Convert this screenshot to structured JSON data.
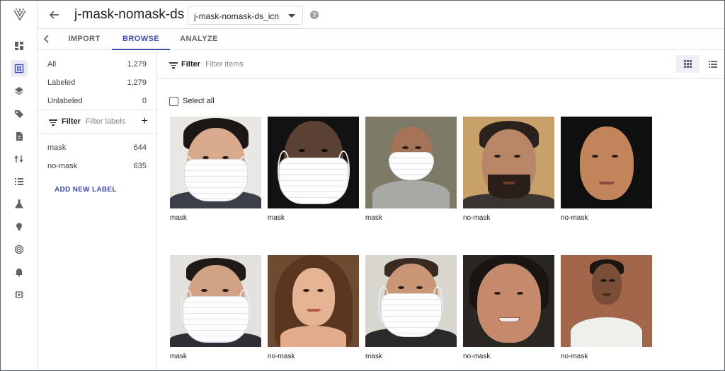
{
  "header": {
    "title": "j-mask-nomask-ds",
    "dataset_select": "j-mask-nomask-ds_icn"
  },
  "rail": {
    "icons": [
      "dashboard-icon",
      "datasets-icon",
      "layers-icon",
      "label-icon",
      "document-icon",
      "pipelines-icon",
      "list-icon",
      "experiments-icon",
      "bulb-icon",
      "target-icon",
      "notifications-icon",
      "settings-chip-icon"
    ]
  },
  "tabs": [
    {
      "label": "IMPORT",
      "active": false
    },
    {
      "label": "BROWSE",
      "active": true
    },
    {
      "label": "ANALYZE",
      "active": false
    }
  ],
  "side": {
    "counts": [
      {
        "label": "All",
        "value": "1,279"
      },
      {
        "label": "Labeled",
        "value": "1,279"
      },
      {
        "label": "Unlabeled",
        "value": "0"
      }
    ],
    "filter_label": "Filter",
    "filter_placeholder": "Filter labels",
    "labels": [
      {
        "label": "mask",
        "value": "644"
      },
      {
        "label": "no-mask",
        "value": "635"
      }
    ],
    "add_label": "ADD NEW LABEL"
  },
  "main": {
    "filter_label": "Filter",
    "filter_placeholder": "Filter items",
    "select_all": "Select all"
  },
  "items": [
    {
      "label": "mask"
    },
    {
      "label": "mask"
    },
    {
      "label": "mask"
    },
    {
      "label": "no-mask"
    },
    {
      "label": "no-mask"
    },
    {
      "label": "mask"
    },
    {
      "label": "no-mask"
    },
    {
      "label": "mask"
    },
    {
      "label": "no-mask"
    },
    {
      "label": "no-mask"
    }
  ],
  "colors": {
    "accent": "#3c4cb0",
    "text": "#202124",
    "muted": "#5f6368",
    "border": "#e0e0e0"
  }
}
